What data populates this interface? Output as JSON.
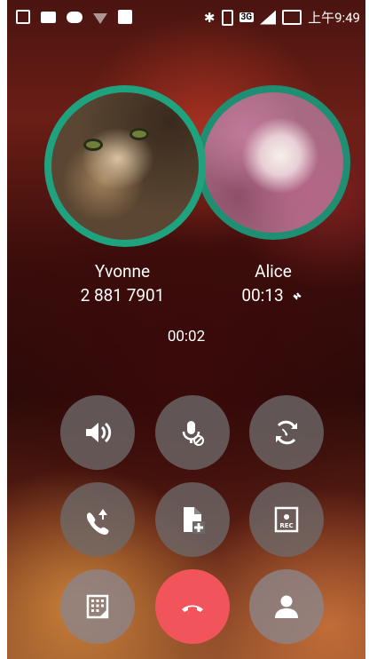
{
  "status_bar": {
    "left_icons": [
      "rec-icon",
      "image-icon",
      "cloud-upload-icon",
      "wifi-question-icon",
      "clipboard-icon"
    ],
    "right_icons": [
      "bluetooth-icon",
      "vibrate-icon",
      "network-3g-icon",
      "signal-icon",
      "battery-charging-icon"
    ],
    "network_label": "3G",
    "time": "上午9:49"
  },
  "callers": [
    {
      "name": "Yvonne",
      "detail": "2 881 7901"
    },
    {
      "name": "Alice",
      "detail": "00:13"
    }
  ],
  "call_timer": "00:02",
  "controls": [
    {
      "id": "speaker",
      "icon": "speaker-icon"
    },
    {
      "id": "mute",
      "icon": "mic-muted-icon"
    },
    {
      "id": "swap",
      "icon": "swap-calls-icon"
    },
    {
      "id": "merge",
      "icon": "merge-calls-icon"
    },
    {
      "id": "add-note",
      "icon": "add-note-icon"
    },
    {
      "id": "record",
      "icon": "rec-icon",
      "label": "REC"
    },
    {
      "id": "keypad",
      "icon": "keypad-icon"
    },
    {
      "id": "end-call",
      "icon": "end-call-icon",
      "color": "#f2545b"
    },
    {
      "id": "contact",
      "icon": "person-icon"
    }
  ],
  "colors": {
    "ring_active": "#1fa37f",
    "ring_hold": "#1f8f74",
    "end_call": "#f2545b"
  }
}
